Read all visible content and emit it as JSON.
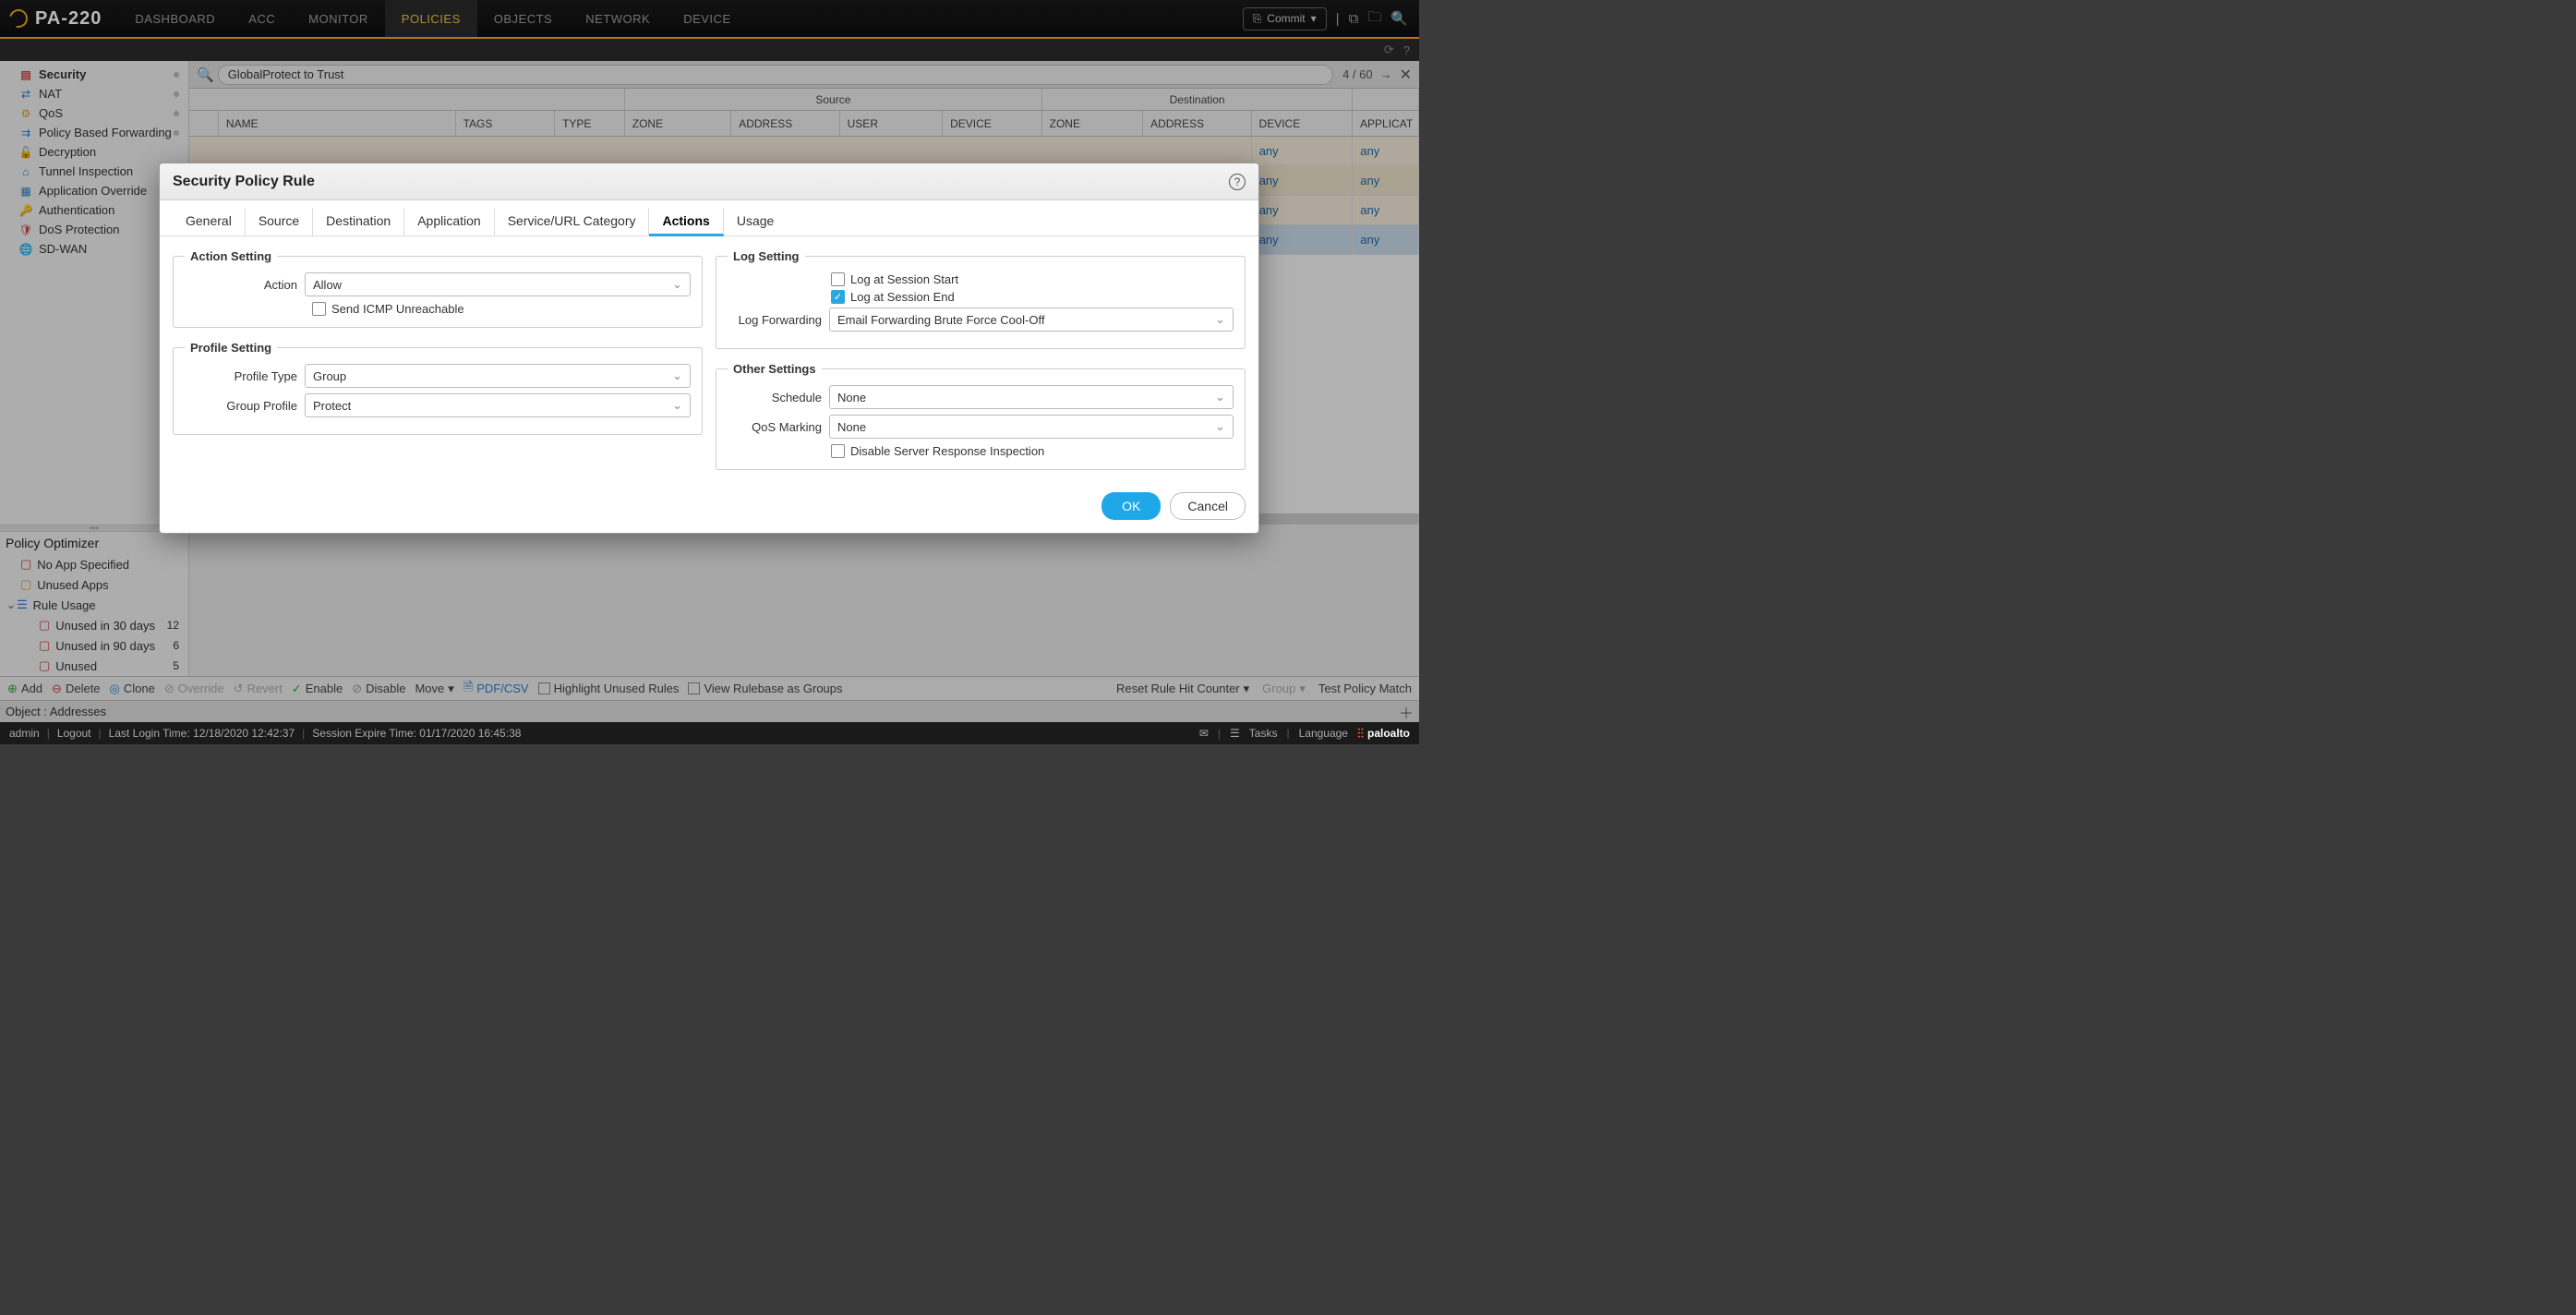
{
  "logo": "PA-220",
  "topnav": [
    "DASHBOARD",
    "ACC",
    "MONITOR",
    "POLICIES",
    "OBJECTS",
    "NETWORK",
    "DEVICE"
  ],
  "topnav_active": 3,
  "commit_label": "Commit",
  "search_value": "GlobalProtect to Trust",
  "search_count": "4 / 60",
  "sidebar": {
    "items": [
      {
        "label": "Security",
        "active": true,
        "icon": "🛡",
        "dot": true,
        "color": "#cc4444"
      },
      {
        "label": "NAT",
        "icon": "↔",
        "dot": true,
        "color": "#2a7fcc"
      },
      {
        "label": "QoS",
        "icon": "⚙",
        "dot": true,
        "color": "#d4a020"
      },
      {
        "label": "Policy Based Forwarding",
        "icon": "⇄",
        "dot": true,
        "color": "#2a7fcc"
      },
      {
        "label": "Decryption",
        "icon": "🔓",
        "dot": false,
        "color": "#d4a020"
      },
      {
        "label": "Tunnel Inspection",
        "icon": "🔍",
        "dot": false,
        "color": "#2a7fcc"
      },
      {
        "label": "Application Override",
        "icon": "▦",
        "dot": false,
        "color": "#2a7fcc"
      },
      {
        "label": "Authentication",
        "icon": "🔑",
        "dot": false,
        "color": "#2a7fcc"
      },
      {
        "label": "DoS Protection",
        "icon": "🛡",
        "dot": false,
        "color": "#cc4444"
      },
      {
        "label": "SD-WAN",
        "icon": "🌐",
        "dot": false,
        "color": "#3a9a3a"
      }
    ]
  },
  "optimizer": {
    "title": "Policy Optimizer",
    "items": [
      {
        "label": "No App Specified"
      },
      {
        "label": "Unused Apps"
      },
      {
        "label": "Rule Usage",
        "expanded": true,
        "children": [
          {
            "label": "Unused in 30 days",
            "count": 12
          },
          {
            "label": "Unused in 90 days",
            "count": 6
          },
          {
            "label": "Unused",
            "count": 5
          }
        ]
      }
    ]
  },
  "grid": {
    "group_headers_top": {
      "source": "Source",
      "destination": "Destination"
    },
    "headers": [
      "",
      "NAME",
      "TAGS",
      "TYPE",
      "ZONE",
      "ADDRESS",
      "USER",
      "DEVICE",
      "ZONE",
      "ADDRESS",
      "DEVICE",
      "APPLICAT"
    ],
    "rows": [
      {
        "ddev": "any",
        "app": "any"
      },
      {
        "ddev": "any",
        "app": "any"
      },
      {
        "ddev": "any",
        "app": "any"
      },
      {
        "ddev": "any",
        "app": "any",
        "sel": true
      }
    ]
  },
  "bottombar": {
    "add": "Add",
    "delete": "Delete",
    "clone": "Clone",
    "override": "Override",
    "revert": "Revert",
    "enable": "Enable",
    "disable": "Disable",
    "move": "Move",
    "pdf": "PDF/CSV",
    "highlight": "Highlight Unused Rules",
    "viewgroups": "View Rulebase as Groups",
    "reset": "Reset Rule Hit Counter",
    "group": "Group",
    "test": "Test Policy Match"
  },
  "objectbar": "Object : Addresses",
  "footer": {
    "user": "admin",
    "logout": "Logout",
    "lastlogin": "Last Login Time: 12/18/2020 12:42:37",
    "expire": "Session Expire Time: 01/17/2020 16:45:38",
    "tasks": "Tasks",
    "language": "Language",
    "brand": "paloalto"
  },
  "dialog": {
    "title": "Security Policy Rule",
    "tabs": [
      "General",
      "Source",
      "Destination",
      "Application",
      "Service/URL Category",
      "Actions",
      "Usage"
    ],
    "active_tab": 5,
    "action_setting": {
      "legend": "Action Setting",
      "action_label": "Action",
      "action_value": "Allow",
      "icmp_label": "Send ICMP Unreachable",
      "icmp_checked": false
    },
    "profile_setting": {
      "legend": "Profile Setting",
      "type_label": "Profile Type",
      "type_value": "Group",
      "group_label": "Group Profile",
      "group_value": "Protect"
    },
    "log_setting": {
      "legend": "Log Setting",
      "start_label": "Log at Session Start",
      "start_checked": false,
      "end_label": "Log at Session End",
      "end_checked": true,
      "fwd_label": "Log Forwarding",
      "fwd_value": "Email Forwarding Brute Force Cool-Off"
    },
    "other_settings": {
      "legend": "Other Settings",
      "sched_label": "Schedule",
      "sched_value": "None",
      "qos_label": "QoS Marking",
      "qos_value": "None",
      "dsri_label": "Disable Server Response Inspection",
      "dsri_checked": false
    },
    "ok": "OK",
    "cancel": "Cancel"
  }
}
